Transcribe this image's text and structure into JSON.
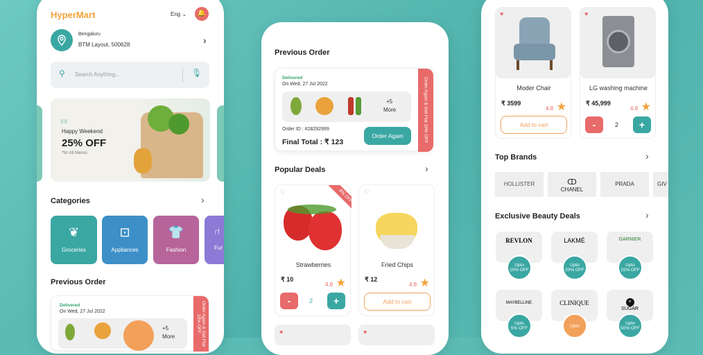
{
  "phone1": {
    "brand": "HyperMart",
    "language": "Eng",
    "location": {
      "city": "Bengaluru",
      "address": "BTM Layout, 500628"
    },
    "search_placeholder": "Search Anything...",
    "banner": {
      "line1": "Happy Weekend",
      "line2": "25% OFF",
      "line3": "*for All Menus"
    },
    "categories_title": "Categories",
    "categories": [
      {
        "label": "Groceries",
        "color": "#3aa7a3"
      },
      {
        "label": "Appliances",
        "color": "#3d8fc7"
      },
      {
        "label": "Fashion",
        "color": "#b7649b"
      },
      {
        "label": "Fur",
        "color": "#8c7ad6"
      }
    ],
    "prev_order_title": "Previous Order",
    "prev_order": {
      "status": "Delivered",
      "date": "On Wed, 27 Jul 2022",
      "more": "+5",
      "more2": "More",
      "ribbon": "Order Again & Get Flat 10% OFF"
    }
  },
  "phone2": {
    "prev_order_title": "Previous Order",
    "order": {
      "status": "Delivered",
      "date": "On Wed, 27 Jul 2022",
      "more": "+5",
      "more2": "More",
      "order_id": "Order ID : #28292999",
      "total": "Final Total : ₹ 123",
      "order_again": "Order Again",
      "ribbon": "Order Again & Get Flat 10% OFF"
    },
    "popular_title": "Popular Deals",
    "deals": [
      {
        "name": "Strawberries",
        "price": "₹ 10",
        "rating": "4.8",
        "badge": "8% OFF",
        "qty": "2"
      },
      {
        "name": "Fried Chips",
        "price": "₹ 12",
        "rating": "4.8",
        "cta": "Add to cart"
      }
    ]
  },
  "phone3": {
    "products": [
      {
        "name": "Moder Chair",
        "price": "₹ 3599",
        "rating": "4.8",
        "cta": "Add to cart"
      },
      {
        "name": "LG washing machine",
        "price": "₹ 45,999",
        "rating": "4.8",
        "qty": "2"
      }
    ],
    "brands_title": "Top Brands",
    "brands": [
      "HOLLISTER",
      "CHANEL",
      "PRADA",
      "GIV"
    ],
    "beauty_title": "Exclusive Beauty Deals",
    "beauty": [
      {
        "brand": "REVLON",
        "upto": "Upto",
        "off": "10% OFF"
      },
      {
        "brand": "LAKMÉ",
        "upto": "Upto",
        "off": "20% OFF"
      },
      {
        "brand": "GARNIER",
        "upto": "Upto",
        "off": "15% OFF"
      },
      {
        "brand": "MAYBELLINE",
        "upto": "Upto",
        "off": "5% OFF"
      },
      {
        "brand": "CLINIQUE",
        "upto": "Upto",
        "off": ""
      },
      {
        "brand": "SUGAR",
        "upto": "Upto",
        "off": "50% OFF"
      }
    ]
  }
}
